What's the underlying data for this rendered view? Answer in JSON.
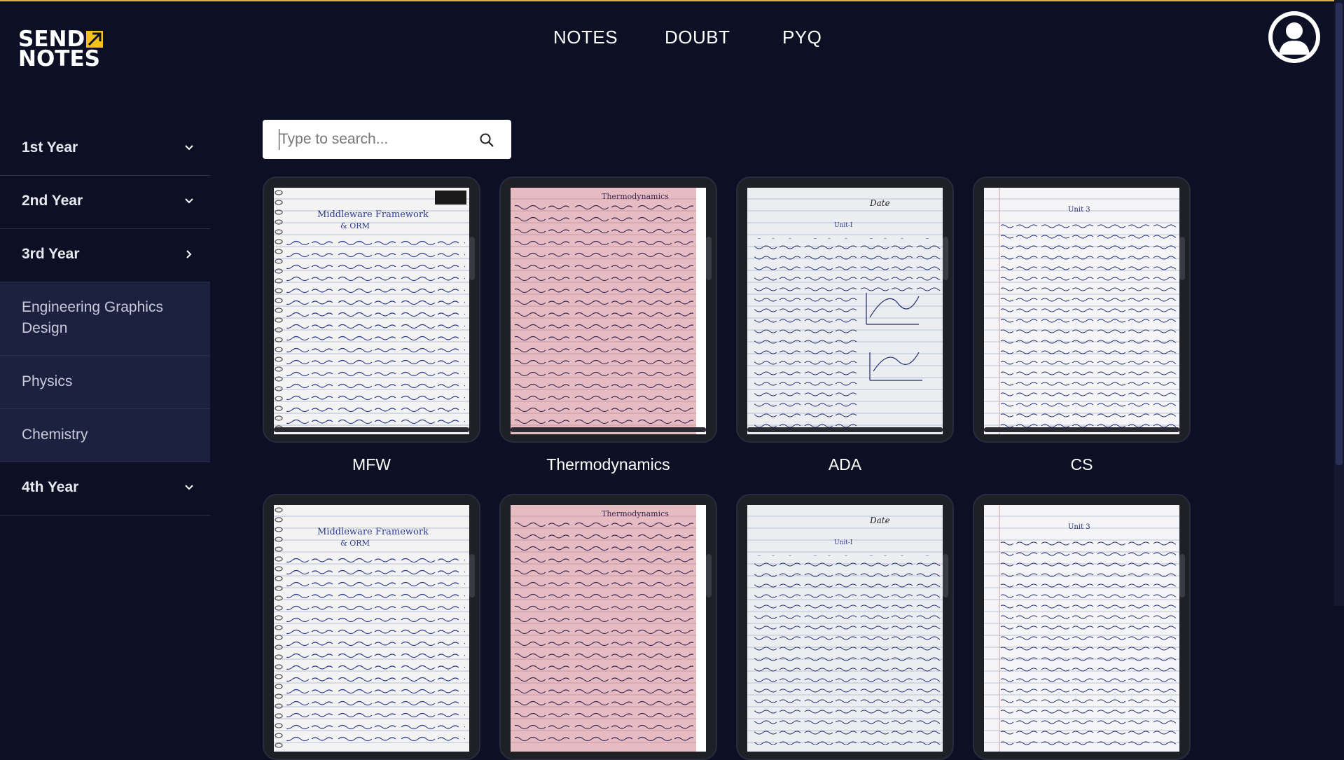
{
  "brand": {
    "line1": "SEND",
    "line2": "NOTES",
    "accent": "#f6c21a"
  },
  "nav": {
    "notes": "NOTES",
    "doubt": "DOUBT",
    "pyq": "PYQ"
  },
  "sidebar": {
    "years": [
      {
        "label": "1st Year",
        "state": "collapsed"
      },
      {
        "label": "2nd Year",
        "state": "collapsed"
      },
      {
        "label": "3rd Year",
        "state": "expanded"
      },
      {
        "label": "4th Year",
        "state": "collapsed"
      }
    ],
    "third_year_subjects": [
      "Engineering Graphics Design",
      "Physics",
      "Chemistry"
    ]
  },
  "search": {
    "placeholder": "Type to search..."
  },
  "notes": [
    {
      "title": "MFW",
      "page_tint": "#f3f3f4"
    },
    {
      "title": "Thermodynamics",
      "page_tint": "#e6bcc2"
    },
    {
      "title": "ADA",
      "page_tint": "#ecedf1"
    },
    {
      "title": "CS",
      "page_tint": "#f5f5f7"
    }
  ],
  "page_text": {
    "mfw_title": "Middleware Framework",
    "mfw_subtitle": "& ORM",
    "thermo_title": "Thermodynamics",
    "ada_date": "Date",
    "ada_unit": "Unit-I",
    "cs_unit": "Unit 3"
  },
  "colors": {
    "background": "#0d1024",
    "sidebar_sub_bg": "#1c2140",
    "ink": "#2b3a8c"
  }
}
